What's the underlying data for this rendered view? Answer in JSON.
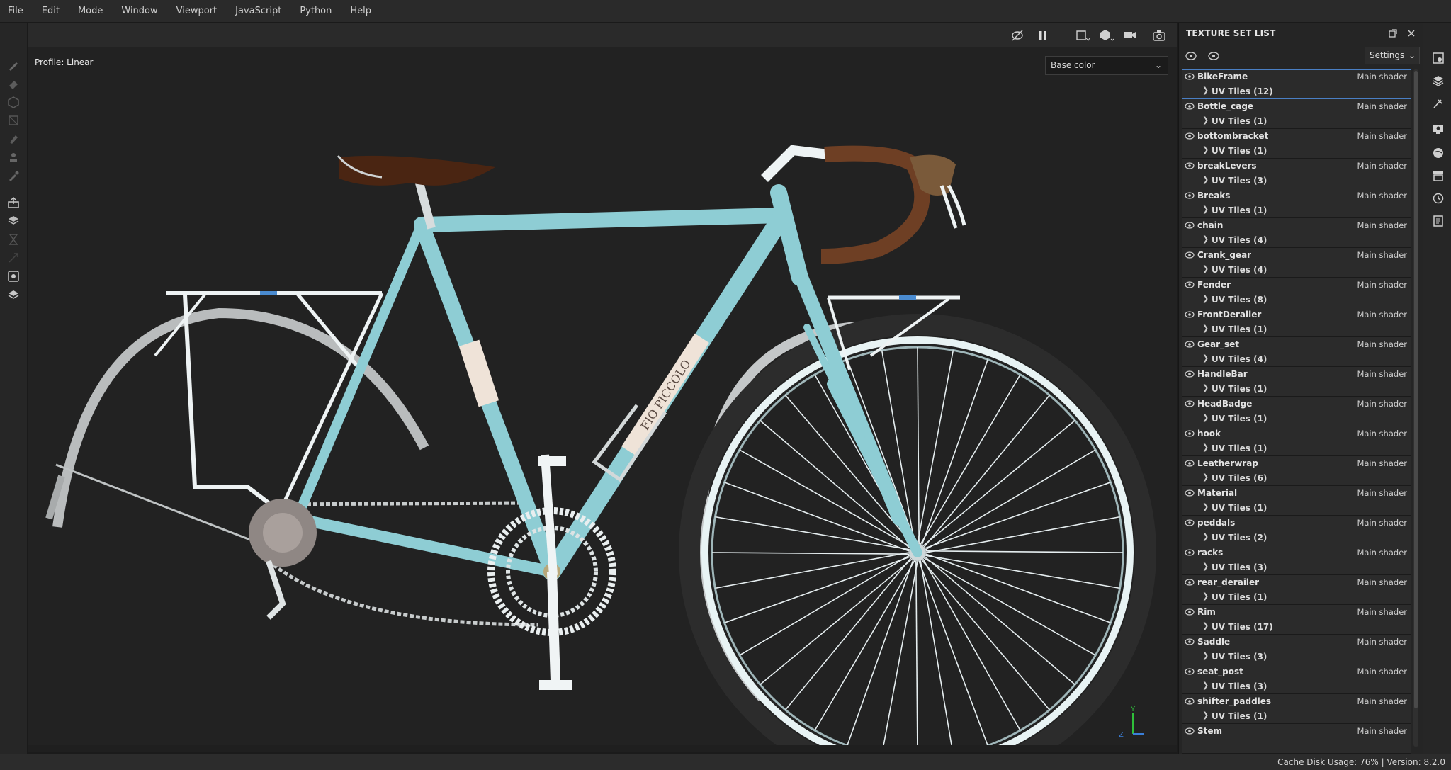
{
  "menu": [
    "File",
    "Edit",
    "Mode",
    "Window",
    "Viewport",
    "JavaScript",
    "Python",
    "Help"
  ],
  "viewport": {
    "profile_label": "Profile: Linear",
    "channel_select": "Base color",
    "frame_decal": "FIO PICCOLO",
    "axis_y": "Y",
    "axis_z": "Z"
  },
  "panel": {
    "title": "TEXTURE SET LIST",
    "settings_label": "Settings",
    "texture_sets": [
      {
        "name": "BikeFrame",
        "shader": "Main shader",
        "uv": "UV Tiles (12)",
        "selected": true
      },
      {
        "name": "Bottle_cage",
        "shader": "Main shader",
        "uv": "UV Tiles (1)"
      },
      {
        "name": "bottombracket",
        "shader": "Main shader",
        "uv": "UV Tiles (1)"
      },
      {
        "name": "breakLevers",
        "shader": "Main shader",
        "uv": "UV Tiles (3)"
      },
      {
        "name": "Breaks",
        "shader": "Main shader",
        "uv": "UV Tiles (1)"
      },
      {
        "name": "chain",
        "shader": "Main shader",
        "uv": "UV Tiles (4)"
      },
      {
        "name": "Crank_gear",
        "shader": "Main shader",
        "uv": "UV Tiles (4)"
      },
      {
        "name": "Fender",
        "shader": "Main shader",
        "uv": "UV Tiles (8)"
      },
      {
        "name": "FrontDerailer",
        "shader": "Main shader",
        "uv": "UV Tiles (1)"
      },
      {
        "name": "Gear_set",
        "shader": "Main shader",
        "uv": "UV Tiles (4)"
      },
      {
        "name": "HandleBar",
        "shader": "Main shader",
        "uv": "UV Tiles (1)"
      },
      {
        "name": "HeadBadge",
        "shader": "Main shader",
        "uv": "UV Tiles (1)"
      },
      {
        "name": "hook",
        "shader": "Main shader",
        "uv": "UV Tiles (1)"
      },
      {
        "name": "Leatherwrap",
        "shader": "Main shader",
        "uv": "UV Tiles (6)"
      },
      {
        "name": "Material",
        "shader": "Main shader",
        "uv": "UV Tiles (1)"
      },
      {
        "name": "peddals",
        "shader": "Main shader",
        "uv": "UV Tiles (2)"
      },
      {
        "name": "racks",
        "shader": "Main shader",
        "uv": "UV Tiles (3)"
      },
      {
        "name": "rear_derailer",
        "shader": "Main shader",
        "uv": "UV Tiles (1)"
      },
      {
        "name": "Rim",
        "shader": "Main shader",
        "uv": "UV Tiles (17)"
      },
      {
        "name": "Saddle",
        "shader": "Main shader",
        "uv": "UV Tiles (3)"
      },
      {
        "name": "seat_post",
        "shader": "Main shader",
        "uv": "UV Tiles (3)"
      },
      {
        "name": "shifter_paddles",
        "shader": "Main shader",
        "uv": "UV Tiles (1)"
      },
      {
        "name": "Stem",
        "shader": "Main shader",
        "uv": ""
      }
    ]
  },
  "status": {
    "text": "Cache Disk Usage: 76% | Version: 8.2.0"
  },
  "colors": {
    "frame": "#8ecdd4",
    "accent": "#4a7fc4",
    "saddle": "#4a2512",
    "wrap": "#6e3f24"
  }
}
